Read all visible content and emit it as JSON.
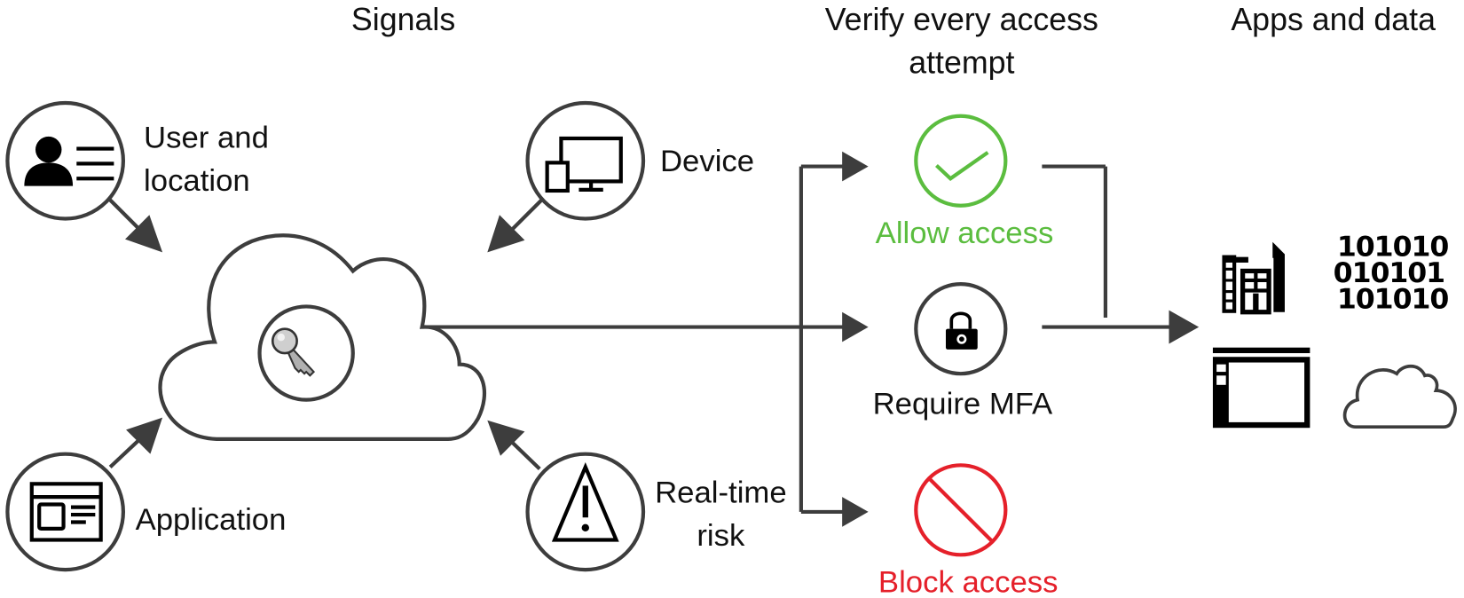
{
  "headers": {
    "signals": "Signals",
    "verify_line1": "Verify every access",
    "verify_line2": "attempt",
    "apps": "Apps and data"
  },
  "signals": [
    {
      "id": "user-location",
      "line1": "User and",
      "line2": "location",
      "icon": "user-card-icon"
    },
    {
      "id": "device",
      "line1": "Device",
      "icon": "devices-icon"
    },
    {
      "id": "application",
      "line1": "Application",
      "icon": "application-window-icon"
    },
    {
      "id": "real-time-risk",
      "line1": "Real-time",
      "line2": "risk",
      "icon": "warning-icon"
    }
  ],
  "policy_engine": {
    "icon": "key-icon",
    "shape": "cloud"
  },
  "decisions": [
    {
      "id": "allow",
      "label": "Allow access",
      "icon": "checkmark-icon",
      "color": "#5bbd3f"
    },
    {
      "id": "mfa",
      "label": "Require MFA",
      "icon": "lock-icon",
      "color": "#111111"
    },
    {
      "id": "block",
      "label": "Block access",
      "icon": "block-icon",
      "color": "#e5202a"
    }
  ],
  "apps_and_data": {
    "icons": [
      "building-icon",
      "binary-data-icon",
      "app-window-icon",
      "cloud-icon"
    ],
    "binary_rows": [
      "101010",
      "010101",
      "101010"
    ]
  },
  "colors": {
    "stroke": "#3d3d3d",
    "allow": "#5bbd3f",
    "block": "#e5202a"
  }
}
